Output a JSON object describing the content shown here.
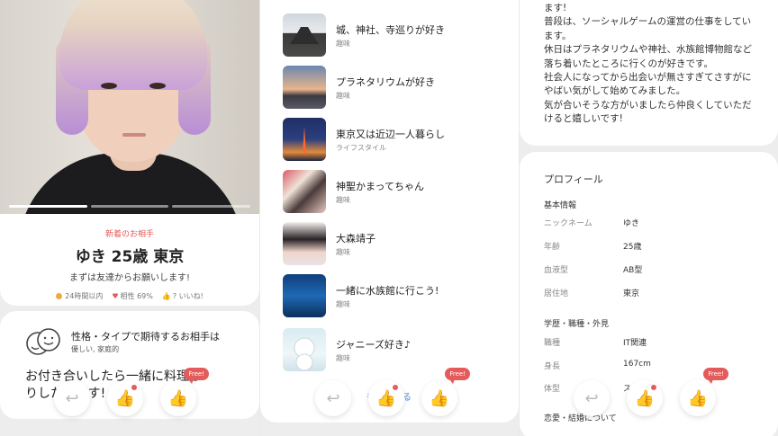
{
  "panel1": {
    "new_badge": "新着のお相手",
    "name_line": "ゆき 25歳 東京",
    "tagline": "まずは友達からお願いします!",
    "meta": {
      "login": "24時間以内",
      "compat": "相性 69%",
      "likes": "? いいね!"
    },
    "pref": {
      "title": "性格・タイプで期待するお相手は",
      "sub": "優しい, 家庭的",
      "body": "お付き合いしたら一緒に料理しりしたいです!"
    }
  },
  "panel2": {
    "items": [
      {
        "title": "城、神社、寺巡りが好き",
        "category": "趣味"
      },
      {
        "title": "プラネタリウムが好き",
        "category": "趣味"
      },
      {
        "title": "東京又は近辺一人暮らし",
        "category": "ライフスタイル"
      },
      {
        "title": "神聖かまってちゃん",
        "category": "趣味"
      },
      {
        "title": "大森靖子",
        "category": "趣味"
      },
      {
        "title": "一緒に水族館に行こう!",
        "category": "趣味"
      },
      {
        "title": "ジャニーズ好き♪",
        "category": "趣味"
      }
    ],
    "more": "もっと見る"
  },
  "panel3": {
    "bio": "ます!\n普段は、ソーシャルゲームの運営の仕事をしています。\n休日はプラネタリウムや神社、水族館博物館など落ち着いたところに行くのが好きです。\n社会人になってから出会いが無さすぎてさすがにやばい気がして始めてみました。\n気が合いそうな方がいましたら仲良くしていただけると嬉しいです!",
    "profile_title": "プロフィール",
    "basic_header": "基本情報",
    "basic": [
      {
        "k": "ニックネーム",
        "v": "ゆき"
      },
      {
        "k": "年齢",
        "v": "25歳"
      },
      {
        "k": "血液型",
        "v": "AB型"
      },
      {
        "k": "居住地",
        "v": "東京"
      }
    ],
    "career_header": "学歴・職種・外見",
    "career": [
      {
        "k": "職種",
        "v": "IT関連"
      },
      {
        "k": "身長",
        "v": "167cm"
      },
      {
        "k": "体型",
        "v": "スリム"
      }
    ],
    "love_header": "恋愛・結婚について"
  },
  "actions": {
    "free_label": "Free!"
  },
  "colors": {
    "accent": "#e45b5b",
    "online": "#f2a93b"
  }
}
